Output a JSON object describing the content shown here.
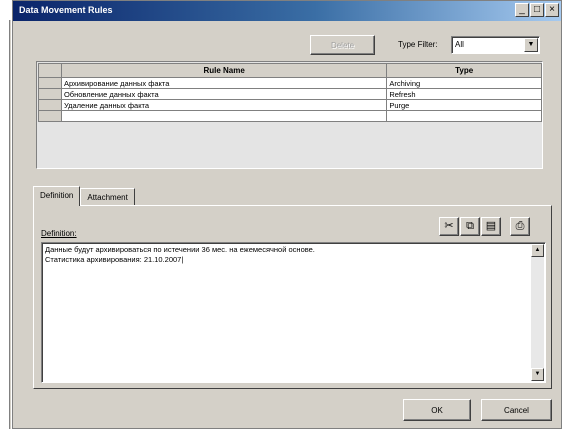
{
  "window": {
    "title": "Data Movement Rules",
    "buttons": {
      "minimize": "_",
      "maximize": "□",
      "close": "×"
    }
  },
  "toolbar": {
    "delete_label": "Delete",
    "type_filter_label": "Type Filter:",
    "type_filter_value": "All"
  },
  "grid": {
    "columns": [
      "Rule Name",
      "Type"
    ],
    "rows": [
      {
        "name": "Архивирование данных факта",
        "type": "Archiving"
      },
      {
        "name": "Обновление данных факта",
        "type": "Refresh"
      },
      {
        "name": "Удаление данных факта",
        "type": "Purge"
      },
      {
        "name": "",
        "type": ""
      }
    ]
  },
  "tabs": [
    {
      "label": "Definition",
      "active": true
    },
    {
      "label": "Attachment",
      "active": false
    }
  ],
  "definition": {
    "label": "Definition:",
    "lines": [
      "Данные будут архивироваться по истечении 36 мес. на ежемесячной основе.",
      "Статистика архивирования: 21.10.2007|"
    ],
    "tool_icons": [
      "cut-icon",
      "copy-icon",
      "paste-icon",
      "preview-icon"
    ]
  },
  "footer": {
    "ok_label": "OK",
    "cancel_label": "Cancel"
  }
}
